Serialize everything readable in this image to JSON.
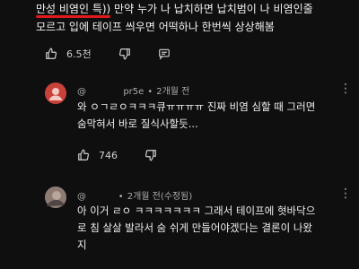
{
  "top_comment": {
    "highlight": "만성 비염인 특))",
    "line1_rest": " 만약 누가 나 납치하면 납치범이 나 비염인줄",
    "line2": "모르고 입에 테이프 씌우면 어떡하나 한번씩 상상해봄",
    "like_count": "6.5천"
  },
  "replies": [
    {
      "author": "@             pr5e",
      "time": "2개월 전",
      "line1": "와 ㅇㄱㄹㅇㅋㅋㅋ큐ㅠㅠㅠㅠ 진짜 비염 심할 때 그러면",
      "line2": "숨막혀서 바로 질식사할듯...",
      "like_count": "746"
    },
    {
      "author": "@          ",
      "time": "2개월 전(수정됨)",
      "line1": "아 이거 ㄹㅇ ㅋㅋㅋㅋㅋㅋㅋ 그래서 테이프에 혓바닥으",
      "line2": "로 침 살살 발라서 숨 쉬게 만들어야겠다는 결론이 나왔",
      "line3": "지"
    }
  ],
  "icons": [
    "thumbs-up-icon",
    "thumbs-down-icon",
    "reply-icon",
    "more-vert-icon"
  ],
  "colors": {
    "background": "#0f0f0f",
    "text": "#f1f1f1",
    "muted": "#aaaaaa",
    "underline": "#e0191b",
    "avatar1": "#c9423a"
  }
}
